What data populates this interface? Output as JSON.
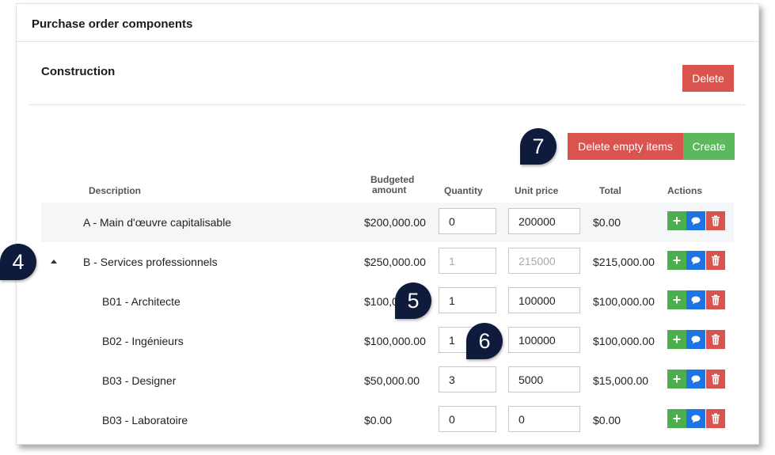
{
  "card": {
    "title": "Purchase order components"
  },
  "section": {
    "title": "Construction",
    "delete_label": "Delete"
  },
  "toolbar": {
    "delete_empty_label": "Delete empty items",
    "create_label": "Create"
  },
  "table": {
    "headers": {
      "description": "Description",
      "budgeted_line1": "Budgeted",
      "budgeted_line2": "amount",
      "quantity": "Quantity",
      "unit_price": "Unit price",
      "total": "Total",
      "actions": "Actions"
    },
    "rows": [
      {
        "description": "A - Main d'œuvre capitalisable",
        "budget": "$200,000.00",
        "quantity": "0",
        "unit_price": "200000",
        "total": "$0.00"
      },
      {
        "description": "B - Services professionnels",
        "budget": "$250,000.00",
        "quantity": "1",
        "unit_price": "215000",
        "total": "$215,000.00"
      },
      {
        "description": "B01 - Architecte",
        "budget": "$100,0",
        "quantity": "1",
        "unit_price": "100000",
        "total": "$100,000.00"
      },
      {
        "description": "B02 - Ingénieurs",
        "budget": "$100,000.00",
        "quantity": "1",
        "unit_price": "100000",
        "total": "$100,000.00"
      },
      {
        "description": "B03 - Designer",
        "budget": "$50,000.00",
        "quantity": "3",
        "unit_price": "5000",
        "total": "$15,000.00"
      },
      {
        "description": "B03 - Laboratoire",
        "budget": "$0.00",
        "quantity": "0",
        "unit_price": "0",
        "total": "$0.00"
      }
    ],
    "action_icons": [
      "plus-icon",
      "comment-icon",
      "trash-icon"
    ]
  },
  "callouts": {
    "c4": "4",
    "c5": "5",
    "c6": "6",
    "c7": "7"
  },
  "colors": {
    "danger": "#d9534f",
    "success": "#5cb85c",
    "info": "#1e74e0",
    "callout": "#0e1b3d"
  }
}
